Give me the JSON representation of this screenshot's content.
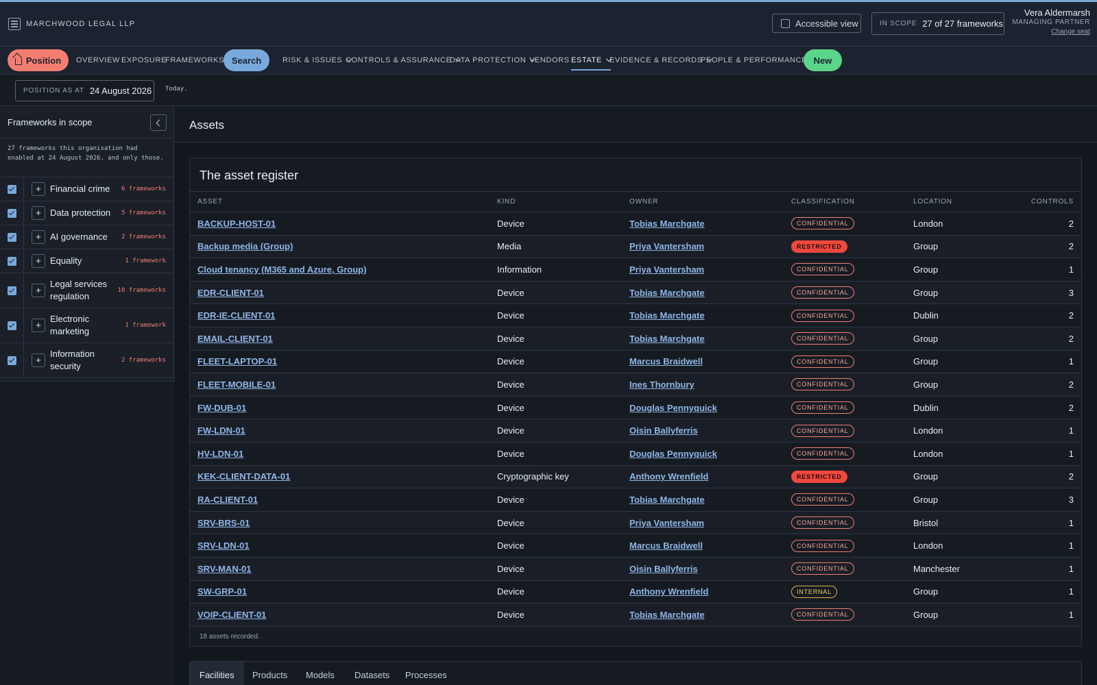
{
  "header": {
    "org": "MARCHWOOD LEGAL LLP",
    "accessible_label": "Accessible view",
    "scope_label": "IN SCOPE",
    "scope_value": "27 of 27 frameworks",
    "user_name": "Vera Aldermarsh",
    "user_role": "MANAGING PARTNER",
    "change_seat": "Change seat"
  },
  "nav": {
    "position": "Position",
    "overview": "OVERVIEW",
    "exposure": "EXPOSURE",
    "frameworks": "FRAMEWORKS",
    "search": "Search",
    "risk": "RISK & ISSUES",
    "controls": "CONTROLS & ASSURANCE",
    "data_protection": "DATA PROTECTION",
    "vendors": "VENDORS",
    "estate": "ESTATE",
    "evidence": "EVIDENCE & RECORDS",
    "people": "PEOPLE & PERFORMANCE",
    "new": "New"
  },
  "subbar": {
    "position_label": "POSITION AS AT",
    "position_date": "24 August 2026",
    "today": "Today."
  },
  "sidebar": {
    "title": "Frameworks in scope",
    "note": "27 frameworks this organisation had enabled at 24 August 2026, and only those.",
    "items": [
      {
        "name": "Financial crime",
        "count": "6 frameworks"
      },
      {
        "name": "Data protection",
        "count": "5 frameworks"
      },
      {
        "name": "AI governance",
        "count": "2 frameworks"
      },
      {
        "name": "Equality",
        "count": "1 framework"
      },
      {
        "name": "Legal services regulation",
        "count": "10 frameworks"
      },
      {
        "name": "Electronic marketing",
        "count": "1 framework"
      },
      {
        "name": "Information security",
        "count": "2 frameworks"
      }
    ]
  },
  "main": {
    "title": "Assets",
    "card_title": "The asset register",
    "columns": [
      "ASSET",
      "KIND",
      "OWNER",
      "CLASSIFICATION",
      "LOCATION",
      "CONTROLS"
    ],
    "rows": [
      {
        "asset": "BACKUP-HOST-01",
        "kind": "Device",
        "owner": "Tobias Marchgate",
        "cls": "CONFIDENTIAL",
        "loc": "London",
        "ctrl": "2"
      },
      {
        "asset": "Backup media (Group)",
        "kind": "Media",
        "owner": "Priya Vantersham",
        "cls": "RESTRICTED",
        "loc": "Group",
        "ctrl": "2"
      },
      {
        "asset": "Cloud tenancy (M365 and Azure, Group)",
        "kind": "Information",
        "owner": "Priya Vantersham",
        "cls": "CONFIDENTIAL",
        "loc": "Group",
        "ctrl": "1"
      },
      {
        "asset": "EDR-CLIENT-01",
        "kind": "Device",
        "owner": "Tobias Marchgate",
        "cls": "CONFIDENTIAL",
        "loc": "Group",
        "ctrl": "3"
      },
      {
        "asset": "EDR-IE-CLIENT-01",
        "kind": "Device",
        "owner": "Tobias Marchgate",
        "cls": "CONFIDENTIAL",
        "loc": "Dublin",
        "ctrl": "2"
      },
      {
        "asset": "EMAIL-CLIENT-01",
        "kind": "Device",
        "owner": "Tobias Marchgate",
        "cls": "CONFIDENTIAL",
        "loc": "Group",
        "ctrl": "2"
      },
      {
        "asset": "FLEET-LAPTOP-01",
        "kind": "Device",
        "owner": "Marcus Braidwell",
        "cls": "CONFIDENTIAL",
        "loc": "Group",
        "ctrl": "1"
      },
      {
        "asset": "FLEET-MOBILE-01",
        "kind": "Device",
        "owner": "Ines Thornbury",
        "cls": "CONFIDENTIAL",
        "loc": "Group",
        "ctrl": "2"
      },
      {
        "asset": "FW-DUB-01",
        "kind": "Device",
        "owner": "Douglas Pennyquick",
        "cls": "CONFIDENTIAL",
        "loc": "Dublin",
        "ctrl": "2"
      },
      {
        "asset": "FW-LDN-01",
        "kind": "Device",
        "owner": "Oisin Ballyferris",
        "cls": "CONFIDENTIAL",
        "loc": "London",
        "ctrl": "1"
      },
      {
        "asset": "HV-LDN-01",
        "kind": "Device",
        "owner": "Douglas Pennyquick",
        "cls": "CONFIDENTIAL",
        "loc": "London",
        "ctrl": "1"
      },
      {
        "asset": "KEK-CLIENT-DATA-01",
        "kind": "Cryptographic key",
        "owner": "Anthony Wrenfield",
        "cls": "RESTRICTED",
        "loc": "Group",
        "ctrl": "2"
      },
      {
        "asset": "RA-CLIENT-01",
        "kind": "Device",
        "owner": "Tobias Marchgate",
        "cls": "CONFIDENTIAL",
        "loc": "Group",
        "ctrl": "3"
      },
      {
        "asset": "SRV-BRS-01",
        "kind": "Device",
        "owner": "Priya Vantersham",
        "cls": "CONFIDENTIAL",
        "loc": "Bristol",
        "ctrl": "1"
      },
      {
        "asset": "SRV-LDN-01",
        "kind": "Device",
        "owner": "Marcus Braidwell",
        "cls": "CONFIDENTIAL",
        "loc": "London",
        "ctrl": "1"
      },
      {
        "asset": "SRV-MAN-01",
        "kind": "Device",
        "owner": "Oisin Ballyferris",
        "cls": "CONFIDENTIAL",
        "loc": "Manchester",
        "ctrl": "1"
      },
      {
        "asset": "SW-GRP-01",
        "kind": "Device",
        "owner": "Anthony Wrenfield",
        "cls": "INTERNAL",
        "loc": "Group",
        "ctrl": "1"
      },
      {
        "asset": "VOIP-CLIENT-01",
        "kind": "Device",
        "owner": "Tobias Marchgate",
        "cls": "CONFIDENTIAL",
        "loc": "Group",
        "ctrl": "1"
      }
    ],
    "footer": "18 assets recorded."
  },
  "tabs": [
    "Facilities",
    "Products",
    "Models",
    "Datasets",
    "Processes"
  ],
  "colors": {
    "accent": "#79a9dc",
    "position_pill": "#f47d72",
    "new_pill": "#5bd58a",
    "confidential": "#f47d72",
    "restricted": "#f0483e",
    "internal": "#e0b548"
  }
}
